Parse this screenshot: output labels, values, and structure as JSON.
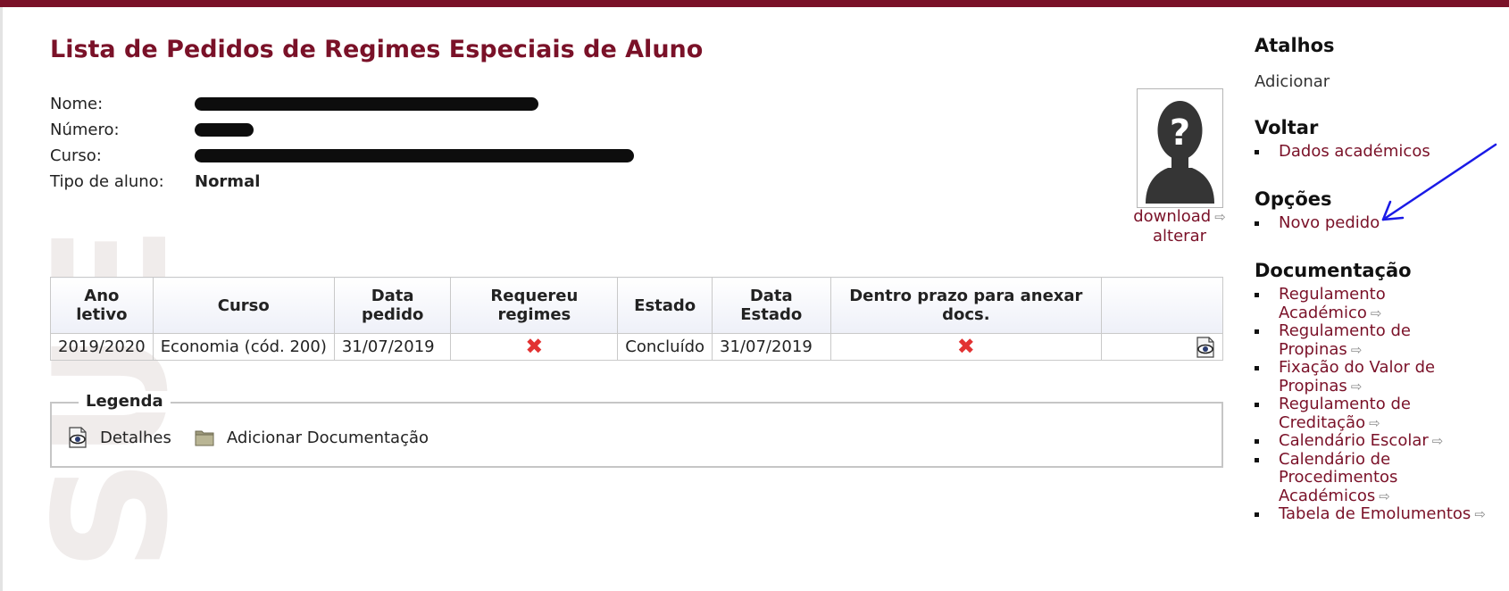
{
  "page": {
    "title": "Lista de Pedidos de Regimes Especiais de Aluno",
    "accent_color": "#7a1128"
  },
  "student": {
    "labels": {
      "name": "Nome:",
      "number": "Número:",
      "course": "Curso:",
      "type": "Tipo de aluno:"
    },
    "type_value": "Normal"
  },
  "photo": {
    "placeholder_glyph": "?",
    "download_label": "download",
    "change_label": "alterar"
  },
  "table": {
    "headers": [
      "Ano letivo",
      "Curso",
      "Data pedido",
      "Requereu regimes",
      "Estado",
      "Data Estado",
      "Dentro prazo para anexar docs.",
      ""
    ],
    "rows": [
      {
        "ano_letivo": "2019/2020",
        "curso": "Economia (cód. 200)",
        "data_pedido": "31/07/2019",
        "requereu_regimes": false,
        "estado": "Concluído",
        "data_estado": "31/07/2019",
        "dentro_prazo": false
      }
    ]
  },
  "legend": {
    "title": "Legenda",
    "items": [
      "Detalhes",
      "Adicionar Documentação"
    ]
  },
  "sidebar": {
    "atalhos_title": "Atalhos",
    "atalhos_text": "Adicionar",
    "voltar_title": "Voltar",
    "voltar_link": "Dados académicos",
    "opcoes_title": "Opções",
    "opcoes_link": "Novo pedido",
    "doc_title": "Documentação",
    "doc_links": [
      "Regulamento Académico",
      "Regulamento de Propinas",
      "Fixação do Valor de Propinas",
      "Regulamento de Creditação",
      "Calendário Escolar",
      "Calendário de Procedimentos Académicos",
      "Tabela de Emolumentos"
    ]
  },
  "icons": {
    "external_link": "external-link-icon",
    "details": "eye-document-icon",
    "folder": "folder-icon",
    "reject": "x-mark-icon"
  },
  "colors": {
    "annotation_arrow": "#1a1ae6",
    "reject_mark": "#e23232"
  }
}
